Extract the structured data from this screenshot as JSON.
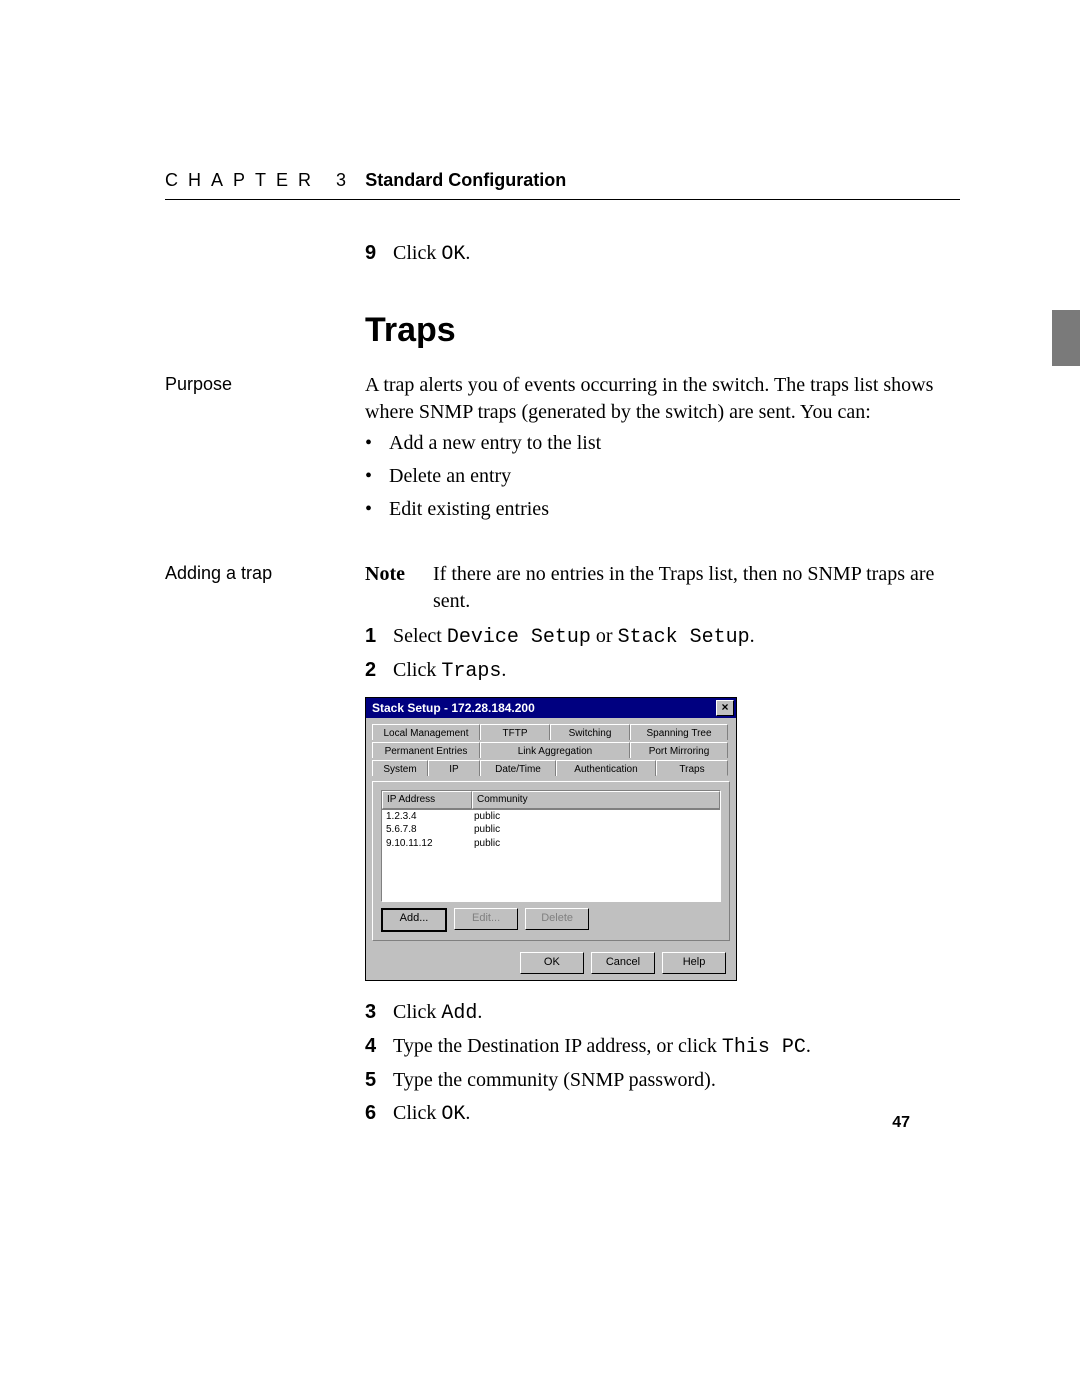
{
  "header": {
    "chapter_label": "CHAPTER 3",
    "title": "Standard Configuration"
  },
  "prev_step": {
    "num": "9",
    "text_a": "Click ",
    "code_a": "OK",
    "text_b": "."
  },
  "section_title": "Traps",
  "purpose": {
    "label": "Purpose",
    "intro": "A trap alerts you of events occurring in the switch. The traps list shows where SNMP traps (generated by the switch) are sent. You can:",
    "bullets": [
      "Add a new entry to the list",
      "Delete an entry",
      "Edit existing entries"
    ]
  },
  "adding": {
    "label": "Adding a trap",
    "note_label": "Note",
    "note_text": "If there are no entries in the Traps list, then no SNMP traps are sent.",
    "steps_before": [
      {
        "num": "1",
        "parts": [
          {
            "t": "Select ",
            "mono": false
          },
          {
            "t": "Device Setup",
            "mono": true
          },
          {
            "t": " or ",
            "mono": false
          },
          {
            "t": "Stack Setup",
            "mono": true
          },
          {
            "t": ".",
            "mono": false
          }
        ]
      },
      {
        "num": "2",
        "parts": [
          {
            "t": "Click ",
            "mono": false
          },
          {
            "t": "Traps",
            "mono": true
          },
          {
            "t": ".",
            "mono": false
          }
        ]
      }
    ],
    "steps_after": [
      {
        "num": "3",
        "parts": [
          {
            "t": "Click ",
            "mono": false
          },
          {
            "t": "Add",
            "mono": true
          },
          {
            "t": ".",
            "mono": false
          }
        ]
      },
      {
        "num": "4",
        "parts": [
          {
            "t": "Type the Destination IP address, or click ",
            "mono": false
          },
          {
            "t": "This PC",
            "mono": true
          },
          {
            "t": ".",
            "mono": false
          }
        ]
      },
      {
        "num": "5",
        "parts": [
          {
            "t": "Type the community (SNMP password).",
            "mono": false
          }
        ]
      },
      {
        "num": "6",
        "parts": [
          {
            "t": "Click ",
            "mono": false
          },
          {
            "t": "OK",
            "mono": true
          },
          {
            "t": ".",
            "mono": false
          }
        ]
      }
    ]
  },
  "dialog": {
    "title": "Stack Setup - 172.28.184.200",
    "tabs_row1": [
      "Local Management",
      "TFTP",
      "Switching",
      "Spanning Tree"
    ],
    "tabs_row2": [
      "Permanent Entries",
      "Link Aggregation",
      "Port Mirroring"
    ],
    "tabs_row3": [
      "System",
      "IP",
      "Date/Time",
      "Authentication",
      "Traps"
    ],
    "active_tab": "Traps",
    "headers": {
      "ip": "IP Address",
      "community": "Community"
    },
    "rows": [
      {
        "ip": "1.2.3.4",
        "community": "public"
      },
      {
        "ip": "5.6.7.8",
        "community": "public"
      },
      {
        "ip": "9.10.11.12",
        "community": "public"
      }
    ],
    "buttons_panel": {
      "add": "Add...",
      "edit": "Edit...",
      "delete": "Delete"
    },
    "buttons_bottom": {
      "ok": "OK",
      "cancel": "Cancel",
      "help": "Help"
    }
  },
  "page_number": "47"
}
